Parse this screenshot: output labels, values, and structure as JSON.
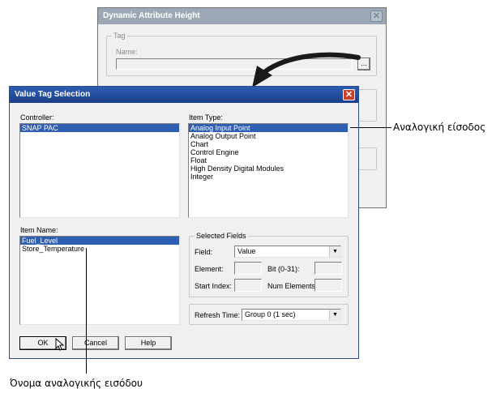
{
  "back_dialog": {
    "title": "Dynamic Attribute   Height",
    "close_glyph": "✕",
    "tag_group_label": "Tag",
    "name_label": "Name:",
    "browse_glyph": "...",
    "name_value": ""
  },
  "dialog": {
    "title": "Value Tag Selection",
    "close_glyph": "✕",
    "controller_label": "Controller:",
    "controllers": [
      "SNAP PAC"
    ],
    "item_type_label": "Item Type:",
    "item_types": [
      "Analog Input Point",
      "Analog Output Point",
      "Chart",
      "Control Engine",
      "Float",
      "High Density Digital Modules",
      "Integer"
    ],
    "item_name_label": "Item Name:",
    "item_names": [
      "Fuel_Level",
      "Store_Temperature"
    ],
    "selected_fields": {
      "legend": "Selected Fields",
      "field_label": "Field:",
      "field_value": "Value",
      "element_label": "Element:",
      "bit_label": "Bit (0-31):",
      "start_index_label": "Start Index:",
      "num_elements_label": "Num Elements:"
    },
    "refresh_label": "Refresh Time:",
    "refresh_value": "Group 0 (1 sec)",
    "buttons": {
      "ok": "OK",
      "cancel": "Cancel",
      "help": "Help"
    }
  },
  "callouts": {
    "analog_input": "Αναλογική είσοδος",
    "analog_input_name": "Όνομα αναλογικής εισόδου"
  },
  "colors": {
    "active_title": "#204a9a",
    "inactive_title": "#9da8b6",
    "selection": "#2f5fb3",
    "close_red": "#c8422b"
  }
}
